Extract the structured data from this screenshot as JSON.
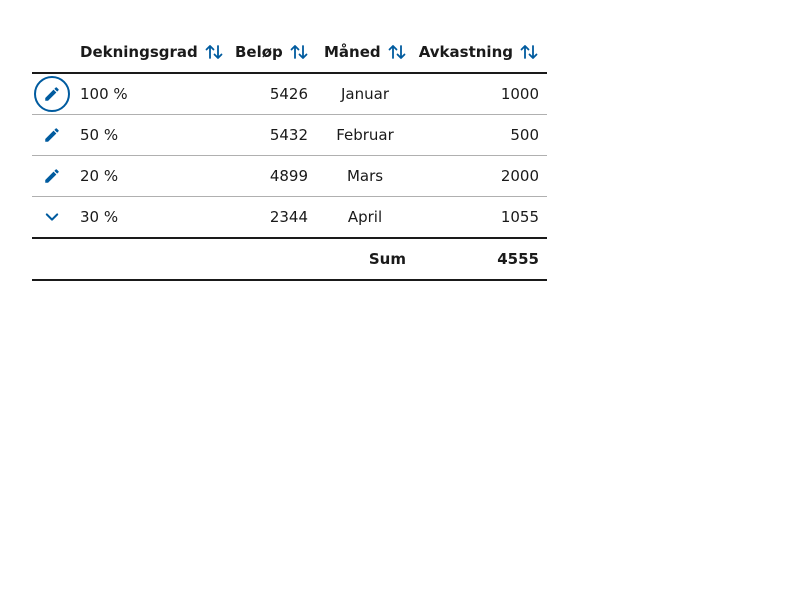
{
  "accent_color": "#005b9f",
  "table": {
    "headers": {
      "dekningsgrad": "Dekningsgrad",
      "belop": "Beløp",
      "maned": "Måned",
      "avkastning": "Avkastning"
    },
    "sort_icon": "sort-arrows-icon",
    "rows": [
      {
        "action_icon": "pencil-icon",
        "dekningsgrad": "100 %",
        "belop": "5426",
        "maned": "Januar",
        "avkastning": "1000"
      },
      {
        "action_icon": "pencil-icon",
        "dekningsgrad": "50 %",
        "belop": "5432",
        "maned": "Februar",
        "avkastning": "500"
      },
      {
        "action_icon": "pencil-icon",
        "dekningsgrad": "20 %",
        "belop": "4899",
        "maned": "Mars",
        "avkastning": "2000"
      },
      {
        "action_icon": "chevron-down-icon",
        "dekningsgrad": "30 %",
        "belop": "2344",
        "maned": "April",
        "avkastning": "1055"
      }
    ],
    "footer": {
      "sum_label": "Sum",
      "sum_value": "4555"
    }
  }
}
